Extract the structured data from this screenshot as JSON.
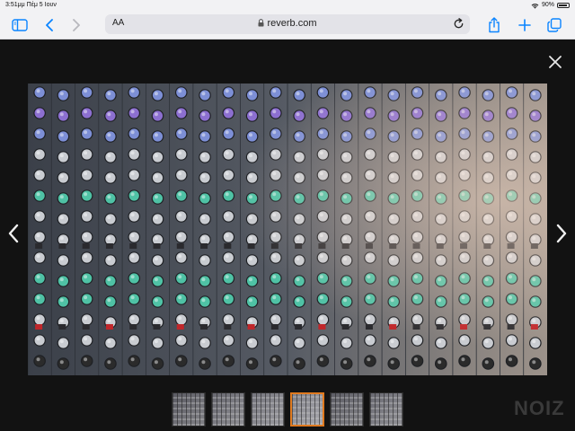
{
  "status_bar": {
    "time": "3:51μμ",
    "date": "Πέμ 5 Ιουν",
    "battery_percent": "90%"
  },
  "toolbar": {
    "aa_label": "AA",
    "url": "reverb.com"
  },
  "gallery": {
    "thumbnail_count": 6,
    "active_thumbnail_index": 3
  },
  "watermark": "NOIZ",
  "colors": {
    "chrome_bg": "#f2f2f4",
    "address_bg": "#e3e3e8",
    "accent_blue": "#0a84ff",
    "viewer_bg": "#121212",
    "active_thumb_border": "#e07a1f"
  },
  "icons": {
    "sidebar": "sidebar-icon",
    "back": "chevron-left-icon",
    "forward": "chevron-right-icon",
    "lock": "lock-icon",
    "reload": "reload-icon",
    "share": "share-icon",
    "new_tab": "plus-icon",
    "tabs": "tabs-icon",
    "close": "close-icon",
    "prev": "chevron-left-icon",
    "next": "chevron-right-icon",
    "wifi": "wifi-icon",
    "battery": "battery-icon"
  }
}
